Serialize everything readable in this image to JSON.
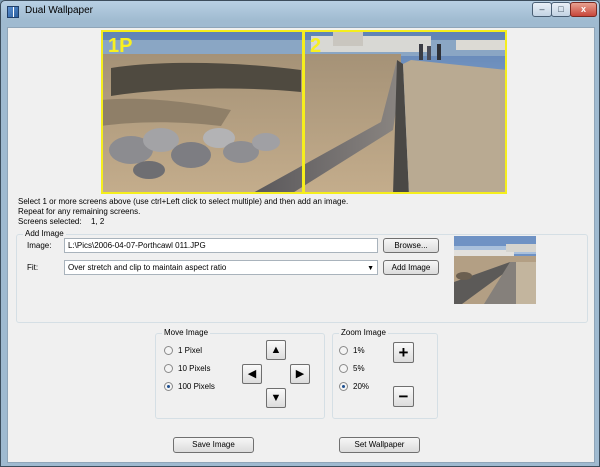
{
  "window": {
    "title": "Dual Wallpaper",
    "minimize_glyph": "–",
    "maximize_glyph": "□",
    "close_glyph": "x"
  },
  "preview": {
    "screens": [
      {
        "label": "1P"
      },
      {
        "label": "2"
      }
    ]
  },
  "instructions": {
    "line1": "Select 1 or more screens above (use ctrl+Left click to select multiple) and then add an image.",
    "line2": "Repeat for any remaining screens.",
    "screens_selected_label": "Screens selected:",
    "screens_selected_value": "1, 2"
  },
  "add_image": {
    "group_title": "Add Image",
    "image_label": "Image:",
    "image_path": "L:\\Pics\\2006-04-07-Porthcawl 011.JPG",
    "browse_label": "Browse...",
    "fit_label": "Fit:",
    "fit_value": "Over stretch and clip to maintain aspect ratio",
    "add_image_label": "Add Image"
  },
  "move_image": {
    "group_title": "Move Image",
    "options": [
      {
        "label": "1 Pixel",
        "selected": false
      },
      {
        "label": "10 Pixels",
        "selected": false
      },
      {
        "label": "100 Pixels",
        "selected": true
      }
    ],
    "up_icon": "▲",
    "down_icon": "▼",
    "left_icon": "◀",
    "right_icon": "▶"
  },
  "zoom_image": {
    "group_title": "Zoom Image",
    "options": [
      {
        "label": "1%",
        "selected": false
      },
      {
        "label": "5%",
        "selected": false
      },
      {
        "label": "20%",
        "selected": true
      }
    ],
    "plus_icon": "+",
    "minus_icon": "−"
  },
  "actions": {
    "save_label": "Save Image",
    "set_label": "Set Wallpaper"
  },
  "colors": {
    "selection_border": "#f5ee1d",
    "window_frame": "#9fbad0"
  }
}
